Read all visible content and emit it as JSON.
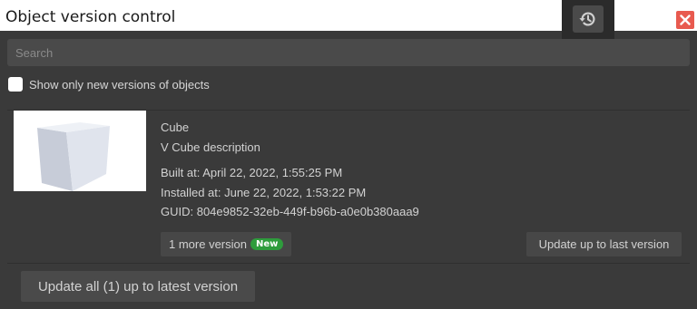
{
  "window": {
    "title": "Object version control"
  },
  "toolbar": {
    "history_icon": "history-icon",
    "close_icon": "close-icon",
    "close_color": "#e85a4f"
  },
  "search": {
    "placeholder": "Search",
    "value": ""
  },
  "filter": {
    "label": "Show only new versions of objects",
    "checked": false
  },
  "object": {
    "name": "Cube",
    "description": "V Cube description",
    "built_at": "Built at: April 22, 2022, 1:55:25 PM",
    "installed_at": "Installed at: June 22, 2022, 1:53:22 PM",
    "guid": "GUID: 804e9852-32eb-449f-b96b-a0e0b380aaa9",
    "more_versions_label": "1 more version",
    "new_badge": "New",
    "update_last_label": "Update up to last version"
  },
  "footer": {
    "update_all_label": "Update all (1) up to latest version"
  },
  "colors": {
    "background": "#3a3a3a",
    "badge": "#2e9c3c"
  }
}
